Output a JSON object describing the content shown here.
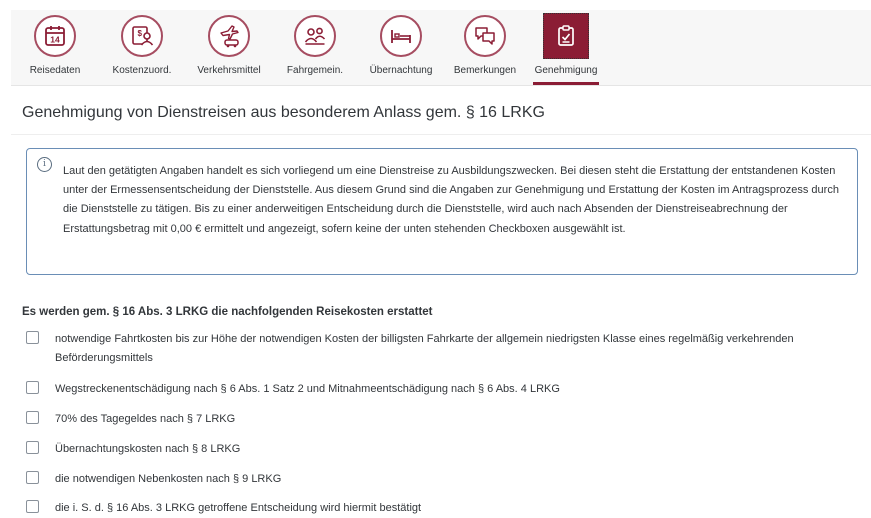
{
  "wizard": {
    "steps": [
      {
        "label": "Reisedaten",
        "icon": "calendar-icon"
      },
      {
        "label": "Kostenzuord.",
        "icon": "cost-assignment-icon"
      },
      {
        "label": "Verkehrsmittel",
        "icon": "transport-icon"
      },
      {
        "label": "Fahrgemein.",
        "icon": "carpool-icon"
      },
      {
        "label": "Übernachtung",
        "icon": "bed-icon"
      },
      {
        "label": "Bemerkungen",
        "icon": "comments-icon"
      },
      {
        "label": "Genehmigung",
        "icon": "approval-clipboard-icon",
        "active": true
      }
    ],
    "calendar_day": "14",
    "accent_color": "#8b1d35",
    "circle_border_color": "#a64d61"
  },
  "page": {
    "title": "Genehmigung von Dienstreisen aus besonderem Anlass gem. § 16 LRKG"
  },
  "info": {
    "icon": "info-icon",
    "text": "Laut den getätigten Angaben handelt es sich vorliegend um eine Dienstreise zu Ausbildungszwecken. Bei diesen steht die Erstattung der entstandenen Kosten unter der Ermessensentscheidung der Dienststelle. Aus diesem Grund sind die Angaben zur Genehmigung und Erstattung der Kosten im Antragsprozess durch die Dienststelle zu tätigen. Bis zu einer anderweitigen Entscheidung durch die Dienststelle, wird auch nach Absenden der Dienstreiseabrechnung der Erstattungsbetrag mit 0,00 € ermittelt und angezeigt, sofern keine der unten stehenden Checkboxen ausgewählt ist."
  },
  "section": {
    "heading": "Es werden gem. § 16 Abs. 3 LRKG die nachfolgenden Reisekosten erstattet",
    "checkboxes": [
      {
        "label": "notwendige Fahrtkosten bis zur Höhe der notwendigen Kosten der billigsten Fahrkarte der allgemein niedrigsten Klasse eines regelmäßig verkehrenden Beförderungsmittels",
        "checked": false
      },
      {
        "label": "Wegstreckenentschädigung nach § 6 Abs. 1 Satz 2 und Mitnahmeentschädigung nach § 6 Abs. 4 LRKG",
        "checked": false
      },
      {
        "label": "70% des Tagegeldes nach § 7 LRKG",
        "checked": false
      },
      {
        "label": "Übernachtungskosten nach § 8 LRKG",
        "checked": false
      },
      {
        "label": "die notwendigen Nebenkosten nach § 9 LRKG",
        "checked": false
      },
      {
        "label": "die i. S. d. § 16 Abs. 3 LRKG getroffene Entscheidung wird hiermit bestätigt",
        "checked": false
      }
    ]
  }
}
